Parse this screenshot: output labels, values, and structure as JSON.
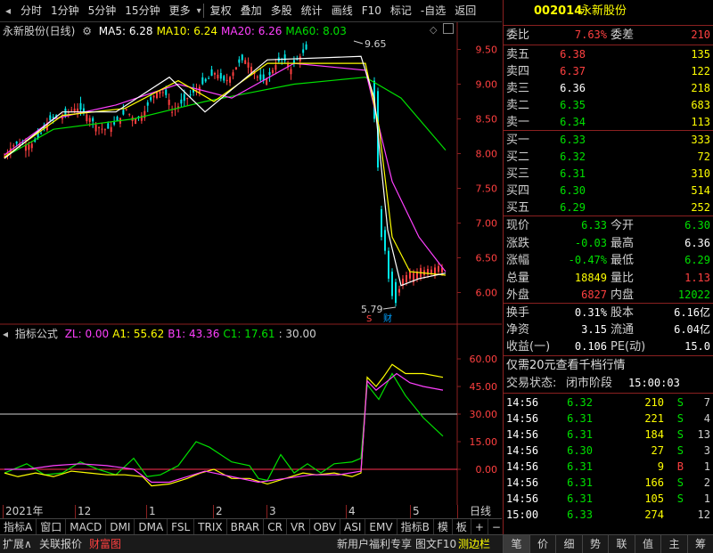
{
  "toolbar": {
    "items": [
      "分时",
      "1分钟",
      "5分钟",
      "15分钟",
      "更多",
      "复权",
      "叠加",
      "多股",
      "统计",
      "画线",
      "F10",
      "标记",
      "-自选",
      "返回"
    ]
  },
  "price_chart": {
    "stock_name": "永新股份(日线)",
    "ma_labels": [
      {
        "text": "MA5: 6.28",
        "color": "#ffffff"
      },
      {
        "text": "MA10: 6.24",
        "color": "#ffff00"
      },
      {
        "text": "MA20: 6.26",
        "color": "#ff40ff"
      },
      {
        "text": "MA60: 8.03",
        "color": "#00e000"
      }
    ],
    "y_ticks": [
      "9.50",
      "9.00",
      "8.50",
      "8.00",
      "7.50",
      "7.00",
      "6.50",
      "6.00"
    ],
    "high_marker": "9.65",
    "low_marker": "5.79",
    "s_marker": "S",
    "cai_marker": "财"
  },
  "indicator_chart": {
    "title": "指标公式",
    "labels": [
      {
        "text": "ZL: 0.00",
        "color": "#ff40ff"
      },
      {
        "text": "A1: 55.62",
        "color": "#ffff00"
      },
      {
        "text": "B1: 43.36",
        "color": "#ff40ff"
      },
      {
        "text": "C1: 17.61",
        "color": "#00e000"
      },
      {
        "text": ": 30.00",
        "color": "#d0d0d0"
      }
    ],
    "y_ticks": [
      "60.00",
      "45.00",
      "30.00",
      "15.00",
      "0.00"
    ]
  },
  "x_axis": {
    "labels": [
      "2021年",
      "12",
      "1",
      "2",
      "3",
      "4",
      "5"
    ],
    "period": "日线"
  },
  "indicator_tabs": [
    "指标A",
    "窗口",
    "MACD",
    "DMI",
    "DMA",
    "FSL",
    "TRIX",
    "BRAR",
    "CR",
    "VR",
    "OBV",
    "ASI",
    "EMV",
    "指标B",
    "模",
    "板",
    "+",
    "−"
  ],
  "bottom_bar": {
    "left": [
      "扩展∧",
      "关联报价",
      "财富图"
    ],
    "right": [
      "新用户福利专享",
      "图文F10",
      "测边栏"
    ],
    "tabs": [
      "笔",
      "价",
      "细",
      "势",
      "联",
      "值",
      "主",
      "筹"
    ]
  },
  "quote": {
    "code": "002014",
    "name": "永新股份",
    "weibi_label": "委比",
    "weibi": "7.63%",
    "weicha_label": "委差",
    "weicha": "210",
    "asks": [
      {
        "label": "卖五",
        "price": "6.38",
        "vol": "135",
        "color": "#ff4040"
      },
      {
        "label": "卖四",
        "price": "6.37",
        "vol": "122",
        "color": "#ff4040"
      },
      {
        "label": "卖三",
        "price": "6.36",
        "vol": "218",
        "color": "#ffffff"
      },
      {
        "label": "卖二",
        "price": "6.35",
        "vol": "683",
        "color": "#00e000"
      },
      {
        "label": "卖一",
        "price": "6.34",
        "vol": "113",
        "color": "#00e000"
      }
    ],
    "bids": [
      {
        "label": "买一",
        "price": "6.33",
        "vol": "333",
        "color": "#00e000"
      },
      {
        "label": "买二",
        "price": "6.32",
        "vol": "72",
        "color": "#00e000"
      },
      {
        "label": "买三",
        "price": "6.31",
        "vol": "310",
        "color": "#00e000"
      },
      {
        "label": "买四",
        "price": "6.30",
        "vol": "514",
        "color": "#00e000"
      },
      {
        "label": "买五",
        "price": "6.29",
        "vol": "252",
        "color": "#00e000"
      }
    ],
    "stats": [
      {
        "l1": "现价",
        "v1": "6.33",
        "c1": "#00e000",
        "l2": "今开",
        "v2": "6.30",
        "c2": "#00e000"
      },
      {
        "l1": "涨跌",
        "v1": "-0.03",
        "c1": "#00e000",
        "l2": "最高",
        "v2": "6.36",
        "c2": "#ffffff"
      },
      {
        "l1": "涨幅",
        "v1": "-0.47%",
        "c1": "#00e000",
        "l2": "最低",
        "v2": "6.29",
        "c2": "#00e000"
      },
      {
        "l1": "总量",
        "v1": "18849",
        "c1": "#ffff00",
        "l2": "量比",
        "v2": "1.13",
        "c2": "#ff4040"
      },
      {
        "l1": "外盘",
        "v1": "6827",
        "c1": "#ff4040",
        "l2": "内盘",
        "v2": "12022",
        "c2": "#00e000"
      }
    ],
    "stats2": [
      {
        "l1": "换手",
        "v1": "0.31%",
        "l2": "股本",
        "v2": "6.16亿"
      },
      {
        "l1": "净资",
        "v1": "3.15",
        "l2": "流通",
        "v2": "6.04亿"
      },
      {
        "l1": "收益(一)",
        "v1": "0.106",
        "l2": "PE(动)",
        "v2": "15.0"
      }
    ],
    "promo": "仅需20元查看千档行情",
    "status_label": "交易状态:",
    "status_value": "闭市阶段",
    "status_time": "15:00:03",
    "ticks": [
      {
        "time": "14:56",
        "price": "6.32",
        "vol": "210",
        "bs": "S",
        "n": "7"
      },
      {
        "time": "14:56",
        "price": "6.31",
        "vol": "221",
        "bs": "S",
        "n": "4"
      },
      {
        "time": "14:56",
        "price": "6.31",
        "vol": "184",
        "bs": "S",
        "n": "13"
      },
      {
        "time": "14:56",
        "price": "6.30",
        "vol": "27",
        "bs": "S",
        "n": "3"
      },
      {
        "time": "14:56",
        "price": "6.31",
        "vol": "9",
        "bs": "B",
        "n": "1"
      },
      {
        "time": "14:56",
        "price": "6.31",
        "vol": "166",
        "bs": "S",
        "n": "2"
      },
      {
        "time": "14:56",
        "price": "6.31",
        "vol": "105",
        "bs": "S",
        "n": "1"
      },
      {
        "time": "15:00",
        "price": "6.33",
        "vol": "274",
        "bs": "",
        "n": "12"
      }
    ]
  }
}
